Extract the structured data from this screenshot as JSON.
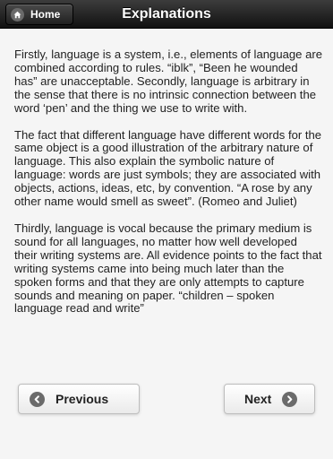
{
  "header": {
    "home_label": "Home",
    "title": "Explanations",
    "home_icon": "home-icon"
  },
  "content": {
    "paragraphs": [
      "Firstly, language is a system, i.e., elements of language are combined according to rules. “iblk”, “Been he wounded has” are unacceptable. Secondly, language is arbitrary in the sense that there is no intrinsic connection between the word ‘pen’ and the thing we use to write with.",
      "The fact that different language have different words for the same object is a good illustration of the arbitrary nature of language. This also explain the symbolic nature of language: words are just symbols; they are associated with objects, actions, ideas, etc, by convention. “A rose by any other name would smell as sweet”. (Romeo and Juliet)",
      "Thirdly, language is vocal because the primary medium is sound for all languages, no matter how well developed their writing systems are. All evidence points to the fact that writing systems came into being much later than the spoken forms and that they are only attempts to capture sounds and meaning on paper. “children – spoken language read and write”"
    ]
  },
  "navigation": {
    "previous_label": "Previous",
    "next_label": "Next",
    "previous_icon": "arrow-left-icon",
    "next_icon": "arrow-right-icon"
  },
  "colors": {
    "header_bg": "#1a1a1a",
    "page_bg": "#f5f5f5",
    "text": "#222222",
    "icon_circle": "#6b6b6b"
  }
}
